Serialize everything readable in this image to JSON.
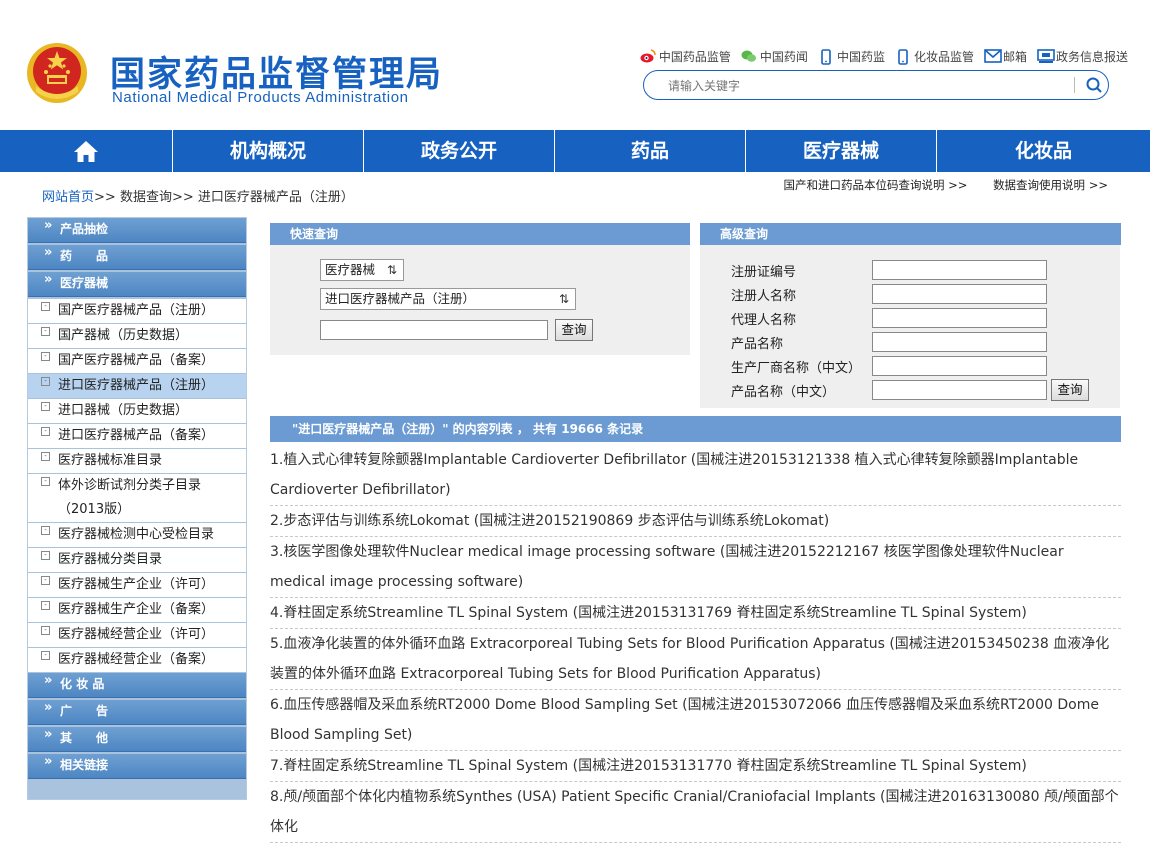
{
  "header": {
    "title_cn": "国家药品监督管理局",
    "title_en": "National Medical Products Administration",
    "toplinks": [
      {
        "icon": "weibo-icon",
        "label": "中国药品监管"
      },
      {
        "icon": "wechat-icon",
        "label": "中国药闻"
      },
      {
        "icon": "mobile-icon",
        "label": "中国药监"
      },
      {
        "icon": "mobile-icon",
        "label": "化妆品监管"
      },
      {
        "icon": "mail-icon",
        "label": "邮箱"
      },
      {
        "icon": "report-icon",
        "label": "政务信息报送"
      }
    ],
    "search_placeholder": "请输入关键字"
  },
  "nav": {
    "home_icon": "home-icon",
    "items": [
      "机构概况",
      "政务公开",
      "药品",
      "医疗器械",
      "化妆品"
    ]
  },
  "breadcrumb": {
    "home": "网站首页",
    "sep1": ">>",
    "level2": "数据查询",
    "sep2": ">>",
    "level3": "进口医疗器械产品（注册）"
  },
  "help_links": [
    "国产和进口药品本位码查询说明 >>",
    "数据查询使用说明 >>"
  ],
  "sidebar": {
    "cat1": "产品抽检",
    "cat2": "药　　品",
    "cat3": "医疗器械",
    "items": [
      "国产医疗器械产品（注册）",
      "国产器械（历史数据）",
      "国产医疗器械产品（备案）",
      "进口医疗器械产品（注册）",
      "进口器械（历史数据）",
      "进口医疗器械产品（备案）",
      "医疗器械标准目录",
      "体外诊断试剂分类子目录（2013版）",
      "医疗器械检测中心受检目录",
      "医疗器械分类目录",
      "医疗器械生产企业（许可）",
      "医疗器械生产企业（备案）",
      "医疗器械经营企业（许可）",
      "医疗器械经营企业（备案）"
    ],
    "cat4": "化 妆 品",
    "cat5": "广　　告",
    "cat6": "其　　他",
    "cat7": "相关链接"
  },
  "quick_query": {
    "title": "快速查询",
    "select1": "医疗器械",
    "select2": "进口医疗器械产品（注册）",
    "input_value": "",
    "button": "查询"
  },
  "advanced_query": {
    "title": "高级查询",
    "fields": [
      "注册证编号",
      "注册人名称",
      "代理人名称",
      "产品名称",
      "生产厂商名称（中文）",
      "产品名称（中文）"
    ],
    "button": "查询"
  },
  "results": {
    "header": "\"进口医疗器械产品（注册）\" 的内容列表 ， 共有 19666 条记录",
    "items": [
      "1.植入式心律转复除颤器Implantable Cardioverter Defibrillator (国械注进20153121338 植入式心律转复除颤器Implantable Cardioverter Defibrillator)",
      "2.步态评估与训练系统Lokomat (国械注进20152190869 步态评估与训练系统Lokomat)",
      "3.核医学图像处理软件Nuclear medical image processing software (国械注进20152212167 核医学图像处理软件Nuclear medical image processing software)",
      "4.脊柱固定系统Streamline TL Spinal System (国械注进20153131769 脊柱固定系统Streamline TL Spinal System)",
      "5.血液净化装置的体外循环血路 Extracorporeal Tubing Sets for Blood Purification Apparatus (国械注进20153450238 血液净化装置的体外循环血路 Extracorporeal Tubing Sets for Blood Purification Apparatus)",
      "6.血压传感器帽及采血系统RT2000 Dome Blood Sampling Set (国械注进20153072066 血压传感器帽及采血系统RT2000 Dome Blood Sampling Set)",
      "7.脊柱固定系统Streamline TL Spinal System (国械注进20153131770 脊柱固定系统Streamline TL Spinal System)",
      "8.颅/颅面部个体化内植物系统Synthes (USA) Patient Specific Cranial/Craniofacial Implants (国械注进20163130080 颅/颅面部个体化"
    ]
  },
  "colors": {
    "brand_blue": "#1762c1",
    "panel_blue": "#6b9bd2",
    "emblem_red": "#d0261f",
    "emblem_gold": "#e8b722"
  }
}
